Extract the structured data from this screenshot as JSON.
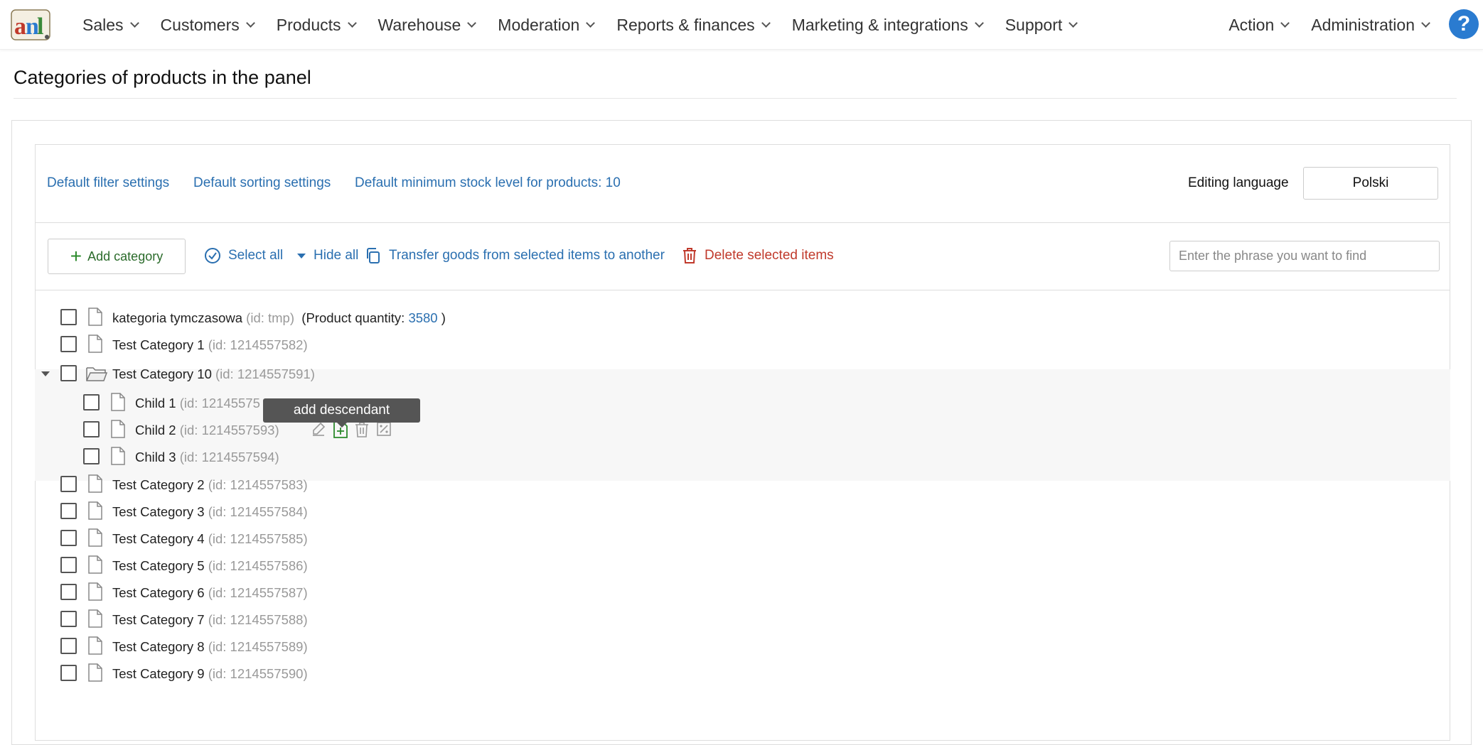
{
  "nav": {
    "logo_name": "app-logo",
    "left_items": [
      {
        "label": "Sales"
      },
      {
        "label": "Customers"
      },
      {
        "label": "Products"
      },
      {
        "label": "Warehouse"
      },
      {
        "label": "Moderation"
      },
      {
        "label": "Reports & finances"
      },
      {
        "label": "Marketing & integrations"
      },
      {
        "label": "Support"
      }
    ],
    "right_items": [
      {
        "label": "Action"
      },
      {
        "label": "Administration"
      }
    ],
    "help_label": "?"
  },
  "page": {
    "title": "Categories of products in the panel"
  },
  "settings": {
    "default_filter": "Default filter settings",
    "default_sorting": "Default sorting settings",
    "min_stock": "Default minimum stock level for products: 10",
    "editing_language_label": "Editing language",
    "editing_language_value": "Polski"
  },
  "toolbar": {
    "add_category": "Add category",
    "select_all": "Select all",
    "hide_all": "Hide all",
    "transfer": "Transfer goods from selected items to another",
    "delete_selected": "Delete selected items",
    "search_placeholder": "Enter the phrase you want to find"
  },
  "tree": {
    "rows": [
      {
        "name": "kategoria tymczasowa",
        "id": "(id: tmp)",
        "qty_label": "(Product quantity: ",
        "qty_value": "3580",
        "qty_end": " )"
      },
      {
        "name": "Test Category 1",
        "id": "(id: 1214557582)"
      },
      {
        "name": "Test Category 10",
        "id": "(id: 1214557591)"
      },
      {
        "name": "Child 1",
        "id": "(id: 12145575"
      },
      {
        "name": "Child 2",
        "id": "(id: 1214557593)"
      },
      {
        "name": "Child 3",
        "id": "(id: 1214557594)"
      },
      {
        "name": "Test Category 2",
        "id": "(id: 1214557583)"
      },
      {
        "name": "Test Category 3",
        "id": "(id: 1214557584)"
      },
      {
        "name": "Test Category 4",
        "id": "(id: 1214557585)"
      },
      {
        "name": "Test Category 5",
        "id": "(id: 1214557586)"
      },
      {
        "name": "Test Category 6",
        "id": "(id: 1214557587)"
      },
      {
        "name": "Test Category 7",
        "id": "(id: 1214557588)"
      },
      {
        "name": "Test Category 8",
        "id": "(id: 1214557589)"
      },
      {
        "name": "Test Category 9",
        "id": "(id: 1214557590)"
      }
    ],
    "tooltip": "add descendant"
  },
  "colors": {
    "link": "#2a6fb0",
    "danger": "#c0392b",
    "success": "#2b8a2b",
    "help_bg": "#2a7bd0"
  }
}
